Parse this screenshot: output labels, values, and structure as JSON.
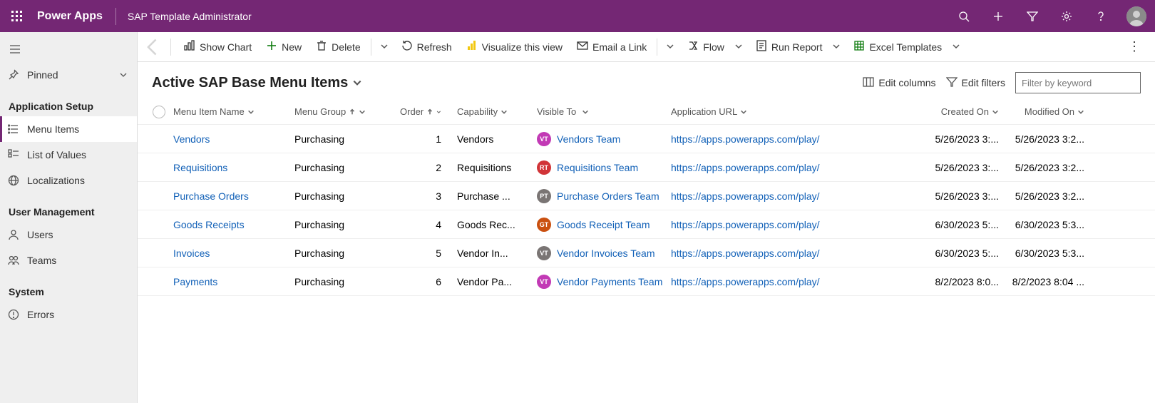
{
  "topbar": {
    "brand": "Power Apps",
    "app_name": "SAP Template Administrator"
  },
  "sidebar": {
    "pinned": "Pinned",
    "sections": {
      "app_setup": "Application Setup",
      "user_mgmt": "User Management",
      "system": "System"
    },
    "items": {
      "menu_items": "Menu Items",
      "list_of_values": "List of Values",
      "localizations": "Localizations",
      "users": "Users",
      "teams": "Teams",
      "errors": "Errors"
    }
  },
  "cmdbar": {
    "show_chart": "Show Chart",
    "new": "New",
    "delete": "Delete",
    "refresh": "Refresh",
    "visualize": "Visualize this view",
    "email_link": "Email a Link",
    "flow": "Flow",
    "run_report": "Run Report",
    "excel_templates": "Excel Templates"
  },
  "view": {
    "title": "Active SAP Base Menu Items",
    "edit_columns": "Edit columns",
    "edit_filters": "Edit filters",
    "filter_placeholder": "Filter by keyword"
  },
  "columns": {
    "name": "Menu Item Name",
    "group": "Menu Group",
    "order": "Order",
    "capability": "Capability",
    "visible_to": "Visible To",
    "url": "Application URL",
    "created": "Created On",
    "modified": "Modified On"
  },
  "rows": [
    {
      "name": "Vendors",
      "group": "Purchasing",
      "order": "1",
      "capability": "Vendors",
      "team_initials": "VT",
      "team_color": "#c23ab5",
      "team": "Vendors Team",
      "url": "https://apps.powerapps.com/play/",
      "created": "5/26/2023 3:...",
      "modified": "5/26/2023 3:2..."
    },
    {
      "name": "Requisitions",
      "group": "Purchasing",
      "order": "2",
      "capability": "Requisitions",
      "team_initials": "RT",
      "team_color": "#d13438",
      "team": "Requisitions Team",
      "url": "https://apps.powerapps.com/play/",
      "created": "5/26/2023 3:...",
      "modified": "5/26/2023 3:2..."
    },
    {
      "name": "Purchase Orders",
      "group": "Purchasing",
      "order": "3",
      "capability": "Purchase ...",
      "team_initials": "PT",
      "team_color": "#7a7574",
      "team": "Purchase Orders Team",
      "url": "https://apps.powerapps.com/play/",
      "created": "5/26/2023 3:...",
      "modified": "5/26/2023 3:2..."
    },
    {
      "name": "Goods Receipts",
      "group": "Purchasing",
      "order": "4",
      "capability": "Goods Rec...",
      "team_initials": "GT",
      "team_color": "#ca5010",
      "team": "Goods Receipt Team",
      "url": "https://apps.powerapps.com/play/",
      "created": "6/30/2023 5:...",
      "modified": "6/30/2023 5:3..."
    },
    {
      "name": "Invoices",
      "group": "Purchasing",
      "order": "5",
      "capability": "Vendor In...",
      "team_initials": "VT",
      "team_color": "#7a7574",
      "team": "Vendor Invoices Team",
      "url": "https://apps.powerapps.com/play/",
      "created": "6/30/2023 5:...",
      "modified": "6/30/2023 5:3..."
    },
    {
      "name": "Payments",
      "group": "Purchasing",
      "order": "6",
      "capability": "Vendor Pa...",
      "team_initials": "VT",
      "team_color": "#c23ab5",
      "team": "Vendor Payments Team",
      "url": "https://apps.powerapps.com/play/",
      "created": "8/2/2023 8:0...",
      "modified": "8/2/2023 8:04 ..."
    }
  ]
}
